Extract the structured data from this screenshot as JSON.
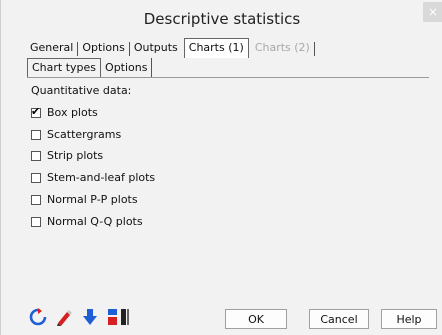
{
  "window": {
    "title": "Descriptive statistics",
    "close_glyph": "×"
  },
  "tabs": [
    {
      "label": "General",
      "state": "normal"
    },
    {
      "label": "Options",
      "state": "normal"
    },
    {
      "label": "Outputs",
      "state": "normal"
    },
    {
      "label": "Charts (1)",
      "state": "active"
    },
    {
      "label": "Charts (2)",
      "state": "disabled"
    }
  ],
  "subtabs": [
    {
      "label": "Chart types",
      "state": "active"
    },
    {
      "label": "Options",
      "state": "normal"
    }
  ],
  "section": {
    "label": "Quantitative data:"
  },
  "checkboxes": [
    {
      "label": "Box plots",
      "checked": true
    },
    {
      "label": "Scattergrams",
      "checked": false
    },
    {
      "label": "Strip plots",
      "checked": false
    },
    {
      "label": "Stem-and-leaf plots",
      "checked": false
    },
    {
      "label": "Normal P-P plots",
      "checked": false
    },
    {
      "label": "Normal Q-Q plots",
      "checked": false
    }
  ],
  "toolbar": {
    "icons": [
      "reset-icon",
      "pencil-icon",
      "download-arrow-icon",
      "selection-toggle-icon"
    ]
  },
  "buttons": {
    "ok": "OK",
    "cancel": "Cancel",
    "help": "Help"
  },
  "colors": {
    "accent_blue": "#1f5fd6",
    "accent_red": "#d61f1f",
    "window_bg": "#f2f2f2"
  }
}
